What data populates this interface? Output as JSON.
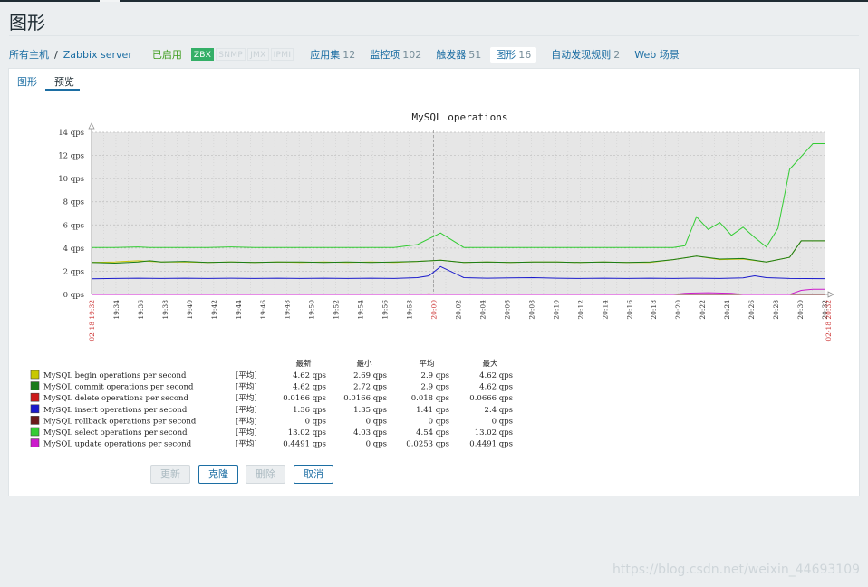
{
  "title": "图形",
  "breadcrumb": {
    "all_hosts": "所有主机",
    "separator": "/",
    "host": "Zabbix server"
  },
  "host_status": "已启用",
  "availability": [
    {
      "label": "ZBX",
      "active": true
    },
    {
      "label": "SNMP",
      "active": false
    },
    {
      "label": "JMX",
      "active": false
    },
    {
      "label": "IPMI",
      "active": false
    }
  ],
  "host_links": [
    {
      "label": "应用集",
      "count": "12",
      "active": false
    },
    {
      "label": "监控项",
      "count": "102",
      "active": false
    },
    {
      "label": "触发器",
      "count": "51",
      "active": false
    },
    {
      "label": "图形",
      "count": "16",
      "active": true
    },
    {
      "label": "自动发现规则",
      "count": "2",
      "active": false
    },
    {
      "label": "Web 场景",
      "count": "",
      "active": false
    }
  ],
  "tabs": {
    "graph": "图形",
    "preview": "预览",
    "selected": "预览"
  },
  "chart_data": {
    "type": "line",
    "title": "MySQL operations",
    "y_unit": "qps",
    "ylim": [
      0,
      14
    ],
    "y_ticks": [
      "0 qps",
      "2 qps",
      "4 qps",
      "6 qps",
      "8 qps",
      "10 qps",
      "12 qps",
      "14 qps"
    ],
    "x_range": [
      "19:32",
      "20:32"
    ],
    "x_ticks": [
      "19:34",
      "19:36",
      "19:38",
      "19:40",
      "19:42",
      "19:44",
      "19:46",
      "19:48",
      "19:50",
      "19:52",
      "19:54",
      "19:56",
      "19:58",
      "20:00",
      "20:02",
      "20:04",
      "20:06",
      "20:08",
      "20:10",
      "20:12",
      "20:14",
      "20:16",
      "20:18",
      "20:20",
      "20:22",
      "20:24",
      "20:26",
      "20:28",
      "20:30",
      "20:32"
    ],
    "x_ticks_highlight": [
      "20:00"
    ],
    "start_label": "02-18 19:32",
    "end_label": "02-18 20:32",
    "grid": true,
    "legend_placement": "bottom",
    "legend_headers": [
      "最新",
      "最小",
      "平均",
      "最大"
    ],
    "legend_func": "[平均]",
    "series": [
      {
        "name": "MySQL begin operations per second",
        "color": "#c8c800",
        "latest": "4.62 qps",
        "min": "2.69 qps",
        "avg": "2.9 qps",
        "max": "4.62 qps",
        "points": [
          [
            0,
            2.75
          ],
          [
            2,
            2.8
          ],
          [
            4,
            2.9
          ],
          [
            6,
            2.8
          ],
          [
            8,
            2.8
          ],
          [
            10,
            2.75
          ],
          [
            12,
            2.8
          ],
          [
            14,
            2.75
          ],
          [
            16,
            2.8
          ],
          [
            18,
            2.75
          ],
          [
            20,
            2.8
          ],
          [
            22,
            2.75
          ],
          [
            24,
            2.8
          ],
          [
            26,
            2.75
          ],
          [
            28,
            2.85
          ],
          [
            30,
            2.95
          ],
          [
            32,
            2.75
          ],
          [
            34,
            2.8
          ],
          [
            36,
            2.75
          ],
          [
            38,
            2.8
          ],
          [
            40,
            2.8
          ],
          [
            42,
            2.75
          ],
          [
            44,
            2.8
          ],
          [
            46,
            2.75
          ],
          [
            48,
            2.75
          ],
          [
            50,
            3.0
          ],
          [
            52,
            3.3
          ],
          [
            54,
            3.0
          ],
          [
            56,
            3.05
          ],
          [
            58,
            2.8
          ],
          [
            60,
            3.2
          ],
          [
            61,
            4.62
          ],
          [
            63,
            4.62
          ]
        ]
      },
      {
        "name": "MySQL commit operations per second",
        "color": "#1a7c1a",
        "latest": "4.62 qps",
        "min": "2.72 qps",
        "avg": "2.9 qps",
        "max": "4.62 qps",
        "points": [
          [
            0,
            2.75
          ],
          [
            2,
            2.7
          ],
          [
            4,
            2.8
          ],
          [
            5,
            2.9
          ],
          [
            6,
            2.8
          ],
          [
            8,
            2.85
          ],
          [
            10,
            2.75
          ],
          [
            12,
            2.8
          ],
          [
            14,
            2.75
          ],
          [
            16,
            2.8
          ],
          [
            18,
            2.8
          ],
          [
            20,
            2.75
          ],
          [
            22,
            2.8
          ],
          [
            24,
            2.75
          ],
          [
            26,
            2.8
          ],
          [
            28,
            2.85
          ],
          [
            30,
            2.95
          ],
          [
            32,
            2.75
          ],
          [
            34,
            2.8
          ],
          [
            36,
            2.75
          ],
          [
            38,
            2.8
          ],
          [
            40,
            2.8
          ],
          [
            42,
            2.75
          ],
          [
            44,
            2.8
          ],
          [
            46,
            2.75
          ],
          [
            48,
            2.8
          ],
          [
            50,
            3.0
          ],
          [
            52,
            3.3
          ],
          [
            54,
            3.05
          ],
          [
            56,
            3.1
          ],
          [
            58,
            2.8
          ],
          [
            60,
            3.2
          ],
          [
            61,
            4.62
          ],
          [
            63,
            4.62
          ]
        ]
      },
      {
        "name": "MySQL delete operations per second",
        "color": "#cc1a1a",
        "latest": "0.0166 qps",
        "min": "0.0166 qps",
        "avg": "0.018 qps",
        "max": "0.0666 qps",
        "points": [
          [
            0,
            0
          ],
          [
            28,
            0
          ],
          [
            29,
            0.05
          ],
          [
            30,
            0
          ],
          [
            50,
            0
          ],
          [
            51,
            0.05
          ],
          [
            52,
            0
          ],
          [
            60,
            0
          ],
          [
            61,
            0.02
          ],
          [
            63,
            0.02
          ]
        ]
      },
      {
        "name": "MySQL insert operations per second",
        "color": "#1a1acc",
        "latest": "1.36 qps",
        "min": "1.35 qps",
        "avg": "1.41 qps",
        "max": "2.4 qps",
        "points": [
          [
            0,
            1.35
          ],
          [
            2,
            1.38
          ],
          [
            4,
            1.4
          ],
          [
            6,
            1.38
          ],
          [
            8,
            1.4
          ],
          [
            10,
            1.38
          ],
          [
            12,
            1.4
          ],
          [
            14,
            1.38
          ],
          [
            16,
            1.4
          ],
          [
            18,
            1.38
          ],
          [
            20,
            1.4
          ],
          [
            22,
            1.38
          ],
          [
            24,
            1.4
          ],
          [
            26,
            1.38
          ],
          [
            28,
            1.45
          ],
          [
            29,
            1.6
          ],
          [
            30,
            2.4
          ],
          [
            32,
            1.45
          ],
          [
            34,
            1.4
          ],
          [
            36,
            1.42
          ],
          [
            38,
            1.45
          ],
          [
            40,
            1.4
          ],
          [
            42,
            1.38
          ],
          [
            44,
            1.4
          ],
          [
            46,
            1.38
          ],
          [
            48,
            1.4
          ],
          [
            50,
            1.38
          ],
          [
            52,
            1.4
          ],
          [
            54,
            1.38
          ],
          [
            56,
            1.42
          ],
          [
            57,
            1.6
          ],
          [
            58,
            1.45
          ],
          [
            60,
            1.38
          ],
          [
            63,
            1.36
          ]
        ]
      },
      {
        "name": "MySQL rollback operations per second",
        "color": "#6b1a1a",
        "latest": "0 qps",
        "min": "0 qps",
        "avg": "0 qps",
        "max": "0 qps",
        "points": [
          [
            0,
            0
          ],
          [
            63,
            0
          ]
        ]
      },
      {
        "name": "MySQL select operations per second",
        "color": "#33cc33",
        "latest": "13.02 qps",
        "min": "4.03 qps",
        "avg": "4.54 qps",
        "max": "13.02 qps",
        "points": [
          [
            0,
            4.05
          ],
          [
            2,
            4.05
          ],
          [
            4,
            4.1
          ],
          [
            5,
            4.05
          ],
          [
            8,
            4.05
          ],
          [
            10,
            4.05
          ],
          [
            12,
            4.1
          ],
          [
            14,
            4.05
          ],
          [
            16,
            4.05
          ],
          [
            18,
            4.05
          ],
          [
            20,
            4.05
          ],
          [
            22,
            4.05
          ],
          [
            24,
            4.05
          ],
          [
            26,
            4.05
          ],
          [
            28,
            4.3
          ],
          [
            30,
            5.3
          ],
          [
            32,
            4.05
          ],
          [
            34,
            4.05
          ],
          [
            36,
            4.05
          ],
          [
            38,
            4.05
          ],
          [
            40,
            4.05
          ],
          [
            42,
            4.05
          ],
          [
            44,
            4.05
          ],
          [
            46,
            4.05
          ],
          [
            48,
            4.05
          ],
          [
            50,
            4.05
          ],
          [
            51,
            4.2
          ],
          [
            52,
            6.7
          ],
          [
            53,
            5.6
          ],
          [
            54,
            6.2
          ],
          [
            55,
            5.1
          ],
          [
            56,
            5.8
          ],
          [
            57,
            4.9
          ],
          [
            58,
            4.1
          ],
          [
            59,
            5.7
          ],
          [
            60,
            10.8
          ],
          [
            62,
            13.02
          ],
          [
            63,
            13.02
          ]
        ]
      },
      {
        "name": "MySQL update operations per second",
        "color": "#cc1acc",
        "latest": "0.4491 qps",
        "min": "0 qps",
        "avg": "0.0253 qps",
        "max": "0.4491 qps",
        "points": [
          [
            0,
            0
          ],
          [
            50,
            0
          ],
          [
            51,
            0.1
          ],
          [
            53,
            0.15
          ],
          [
            55,
            0.1
          ],
          [
            56,
            0
          ],
          [
            60,
            0
          ],
          [
            61,
            0.35
          ],
          [
            62,
            0.45
          ],
          [
            63,
            0.45
          ]
        ]
      }
    ]
  },
  "buttons": {
    "update": "更新",
    "clone": "克隆",
    "delete": "删除",
    "cancel": "取消"
  },
  "watermark": "https://blog.csdn.net/weixin_44693109"
}
